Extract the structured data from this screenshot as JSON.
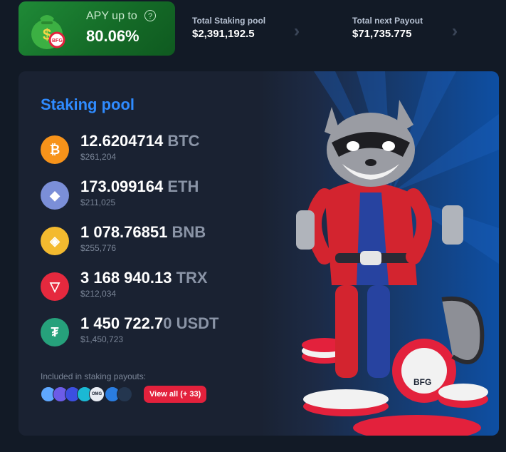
{
  "apy": {
    "label": "APY up to",
    "value": "80.06%",
    "chip_text": "BFG"
  },
  "stats": [
    {
      "label": "Total Staking pool",
      "value": "$2,391,192.5"
    },
    {
      "label": "Total next Payout",
      "value": "$71,735.775"
    }
  ],
  "pool": {
    "title": "Staking pool",
    "coins": [
      {
        "amount": "12.6204714",
        "ticker": "BTC",
        "usd": "$261,204",
        "icon": "bitcoin-icon",
        "color": "#f7931a",
        "glyph": "₿"
      },
      {
        "amount": "173.099164",
        "ticker": "ETH",
        "usd": "$211,025",
        "icon": "ethereum-icon",
        "color": "#7b8fd8",
        "glyph": "◆"
      },
      {
        "amount": "1 078.76851",
        "ticker": "BNB",
        "usd": "$255,776",
        "icon": "bnb-icon",
        "color": "#f3ba2f",
        "glyph": "◈"
      },
      {
        "amount": "3 168 940.13",
        "ticker": "TRX",
        "usd": "$212,034",
        "icon": "tron-icon",
        "color": "#e5293e",
        "glyph": "▽"
      },
      {
        "amount": "1 450 722.7",
        "tail": "0",
        "ticker": "USDT",
        "usd": "$1,450,723",
        "icon": "tether-icon",
        "color": "#26a17b",
        "glyph": "₮"
      }
    ],
    "included_label": "Included in staking payouts:",
    "token_chip_text": "OMG",
    "view_all_label": "View all (+ 33)"
  },
  "colors": {
    "accent": "#2f8bff",
    "apy_green": "#1f8a37",
    "view_all": "#e3213c"
  }
}
